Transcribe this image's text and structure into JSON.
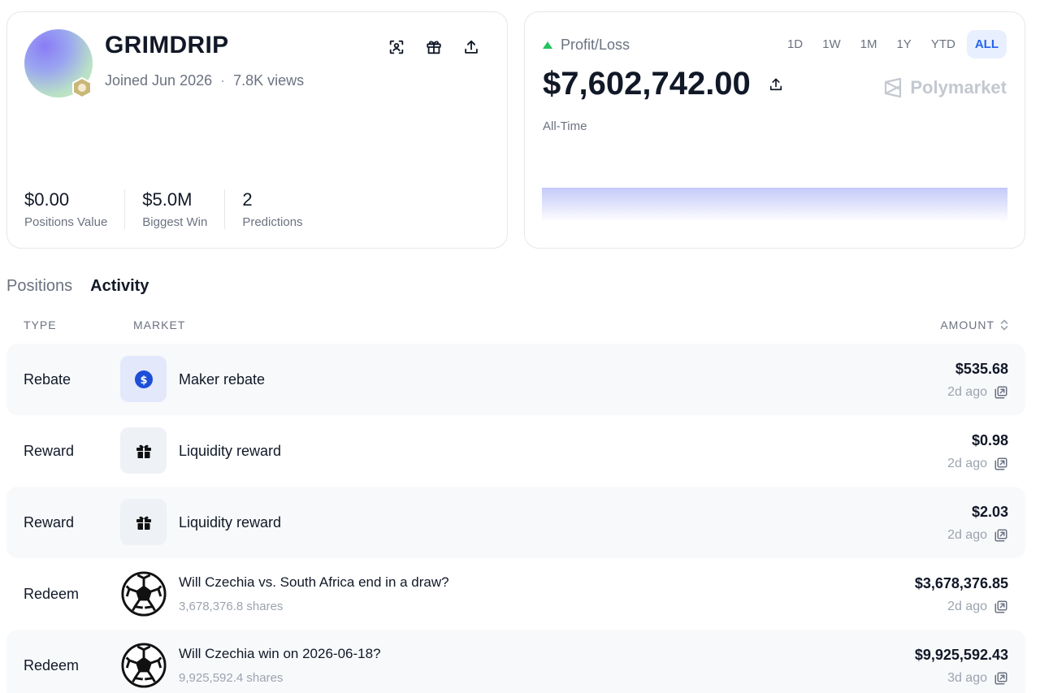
{
  "profile": {
    "username": "GRIMDRIP",
    "joined": "Joined Jun 2026",
    "separator": "·",
    "views": "7.8K views",
    "actions": [
      "face-scan-icon",
      "gift-icon",
      "share-icon"
    ],
    "stats": [
      {
        "value": "$0.00",
        "label": "Positions Value"
      },
      {
        "value": "$5.0M",
        "label": "Biggest Win"
      },
      {
        "value": "2",
        "label": "Predictions"
      }
    ]
  },
  "pnl": {
    "label": "Profit/Loss",
    "value": "$7,602,742.00",
    "period": "All-Time",
    "brand": "Polymarket",
    "ranges": [
      "1D",
      "1W",
      "1M",
      "1Y",
      "YTD",
      "ALL"
    ],
    "active_range": "ALL",
    "trend_color": "#22c55e",
    "accent_color": "#2563eb"
  },
  "tabs": {
    "positions": "Positions",
    "activity": "Activity",
    "active": "Activity"
  },
  "table": {
    "headers": {
      "type": "TYPE",
      "market": "MARKET",
      "amount": "AMOUNT"
    },
    "rows": [
      {
        "type": "Rebate",
        "icon": "dollar-coin-icon",
        "title": "Maker rebate",
        "shares": "",
        "amount": "$535.68",
        "time": "2d ago"
      },
      {
        "type": "Reward",
        "icon": "gift-icon",
        "title": "Liquidity reward",
        "shares": "",
        "amount": "$0.98",
        "time": "2d ago"
      },
      {
        "type": "Reward",
        "icon": "gift-icon",
        "title": "Liquidity reward",
        "shares": "",
        "amount": "$2.03",
        "time": "2d ago"
      },
      {
        "type": "Redeem",
        "icon": "soccer-ball-icon",
        "title": "Will Czechia vs. South Africa end in a draw?",
        "shares": "3,678,376.8 shares",
        "amount": "$3,678,376.85",
        "time": "2d ago"
      },
      {
        "type": "Redeem",
        "icon": "soccer-ball-icon",
        "title": "Will Czechia win on 2026-06-18?",
        "shares": "9,925,592.4 shares",
        "amount": "$9,925,592.43",
        "time": "3d ago"
      }
    ]
  }
}
